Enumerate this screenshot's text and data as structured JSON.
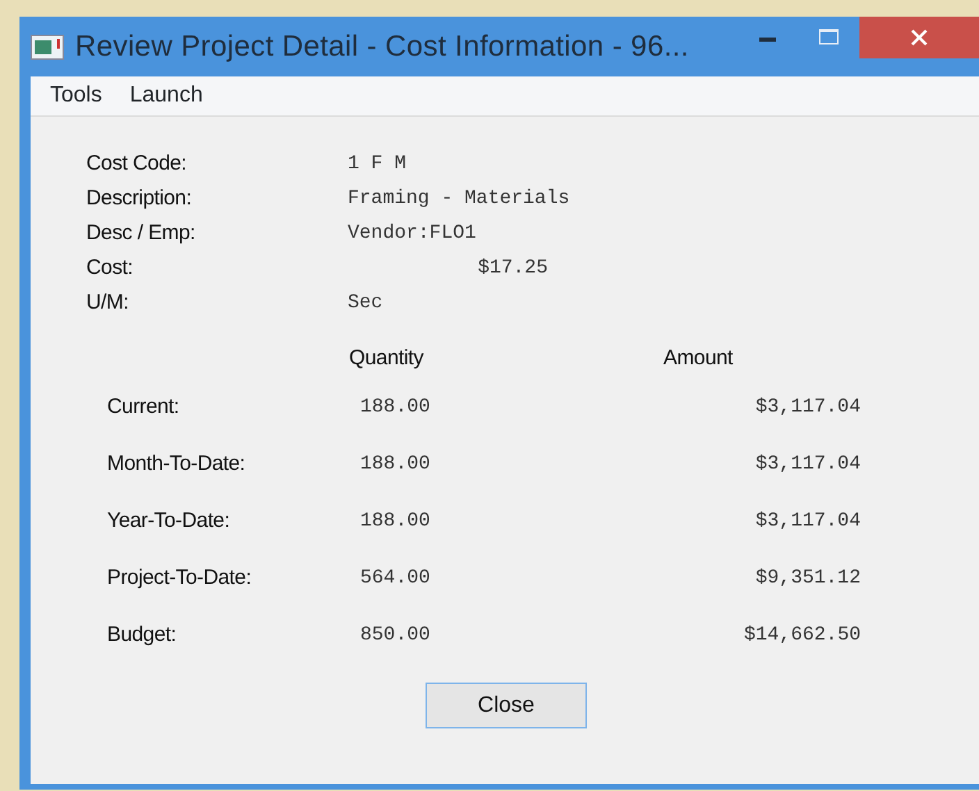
{
  "window": {
    "title": "Review Project Detail - Cost Information - 96..."
  },
  "menu": [
    "Tools",
    "Launch"
  ],
  "fields": [
    {
      "label": "Cost Code:",
      "value": "1 F M",
      "kind": "text"
    },
    {
      "label": "Description:",
      "value": "Framing - Materials",
      "kind": "text"
    },
    {
      "label": "Desc / Emp:",
      "value": "Vendor:FLO1",
      "kind": "text"
    },
    {
      "label": "Cost:",
      "value": "$17.25",
      "kind": "money"
    },
    {
      "label": "U/M:",
      "value": "Sec",
      "kind": "text"
    }
  ],
  "table": {
    "columns": [
      "Quantity",
      "Amount"
    ],
    "rows": [
      {
        "label": "Current:",
        "quantity": "188.00",
        "amount": "$3,117.04"
      },
      {
        "label": "Month-To-Date:",
        "quantity": "188.00",
        "amount": "$3,117.04"
      },
      {
        "label": "Year-To-Date:",
        "quantity": "188.00",
        "amount": "$3,117.04"
      },
      {
        "label": "Project-To-Date:",
        "quantity": "564.00",
        "amount": "$9,351.12"
      },
      {
        "label": "Budget:",
        "quantity": "850.00",
        "amount": "$14,662.50"
      }
    ]
  },
  "buttons": [
    "Close"
  ]
}
